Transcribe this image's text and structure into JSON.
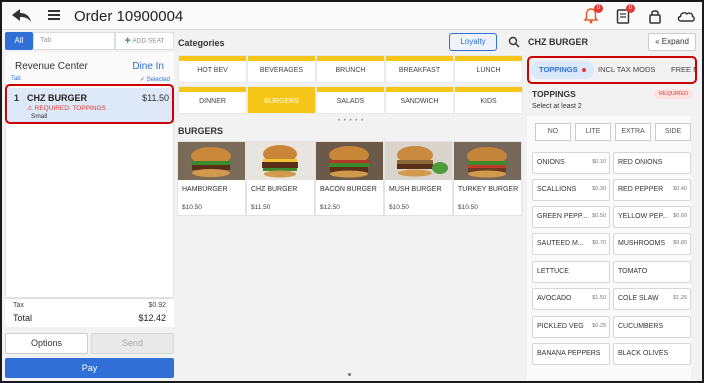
{
  "header": {
    "title": "Order 10900004",
    "notif_badge": "0",
    "note_badge": "0"
  },
  "left": {
    "tab_all": "All",
    "tab_placeholder": "Tab",
    "add_seat": "ADD SEAT",
    "revenue_center": "Revenue Center",
    "dine_in": "Dine In",
    "tab_small": "Tab",
    "selected": "Selected",
    "order_item": {
      "qty": "1",
      "name": "CHZ BURGER",
      "price": "$11.50",
      "required": "REQUIRED: TOPPINGS",
      "modifier": "Small"
    },
    "tax_label": "Tax",
    "tax_value": "$0.92",
    "total_label": "Total",
    "total_value": "$12.42",
    "options": "Options",
    "send": "Send",
    "pay": "Pay"
  },
  "middle": {
    "categories_title": "Categories",
    "loyalty": "Loyalty",
    "categories": [
      "HOT BEV",
      "BEVERAGES",
      "BRUNCH",
      "BREAKFAST",
      "LUNCH",
      "DINNER",
      "BURGERS",
      "SALADS",
      "SANDWICH",
      "KIDS"
    ],
    "active_category": "BURGERS",
    "pager_dots": "• • • • •",
    "section_title": "BURGERS",
    "products": [
      {
        "name": "HAMBURGER",
        "price": "$10.50"
      },
      {
        "name": "CHZ BURGER",
        "price": "$11.50"
      },
      {
        "name": "BACON BURGER",
        "price": "$12.50"
      },
      {
        "name": "MUSH BURGER",
        "price": "$10.50"
      },
      {
        "name": "TURKEY BURGER",
        "price": "$10.50"
      }
    ]
  },
  "right": {
    "title": "CHZ BURGER",
    "expand": "Expand",
    "tabs": [
      "TOPPINGS",
      "INCL TAX MODS",
      "FREE M"
    ],
    "group_title": "TOPPINGS",
    "required_badge": "REQUIRED",
    "select_hint": "Select at least 2",
    "qualifiers": [
      "NO",
      "LITE",
      "EXTRA",
      "SIDE"
    ],
    "options": [
      {
        "name": "ONIONS",
        "price": "$0.10"
      },
      {
        "name": "RED ONIONS",
        "price": ""
      },
      {
        "name": "SCALLIONS",
        "price": "$0.30"
      },
      {
        "name": "RED PEPPER",
        "price": "$0.40"
      },
      {
        "name": "GREEN PEPP...",
        "price": "$0.50"
      },
      {
        "name": "YELLOW PEP...",
        "price": "$0.60"
      },
      {
        "name": "SAUTEED M...",
        "price": "$0.70"
      },
      {
        "name": "MUSHROOMS",
        "price": "$0.80"
      },
      {
        "name": "LETTUCE",
        "price": ""
      },
      {
        "name": "TOMATO",
        "price": ""
      },
      {
        "name": "AVOCADO",
        "price": "$1.50"
      },
      {
        "name": "COLE SLAW",
        "price": "$1.25"
      },
      {
        "name": "PICKLED VEG",
        "price": "$0.25"
      },
      {
        "name": "CUCUMBERS",
        "price": ""
      },
      {
        "name": "BANANA PEPPERS",
        "price": ""
      },
      {
        "name": "BLACK OLIVES",
        "price": ""
      }
    ]
  },
  "colors": {
    "accent": "#2f6fd6",
    "category_yellow": "#f5c518",
    "required_red": "#e53935",
    "highlight_red": "#cc0000"
  }
}
